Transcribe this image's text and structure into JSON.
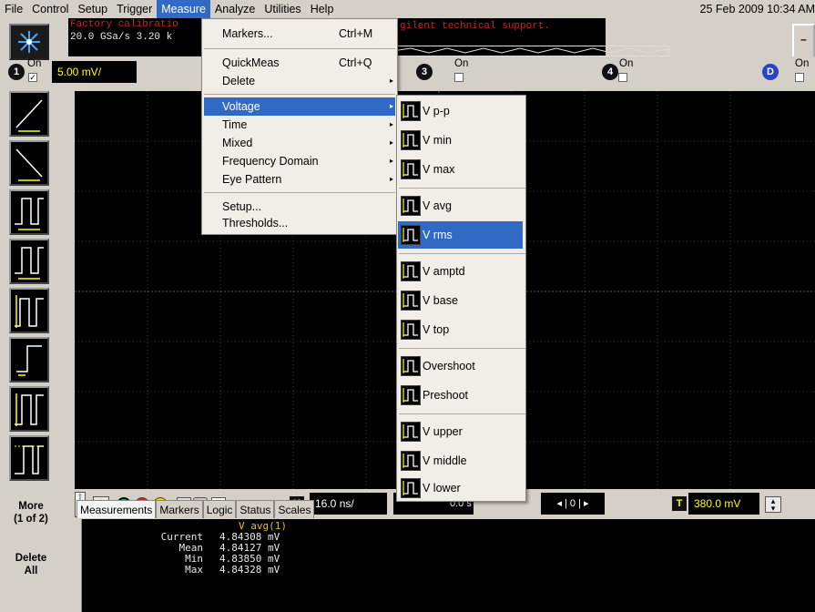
{
  "menubar": {
    "items": [
      "File",
      "Control",
      "Setup",
      "Trigger",
      "Measure",
      "Analyze",
      "Utilities",
      "Help"
    ],
    "active": "Measure",
    "datetime": "25 Feb 2009 10:34 AM"
  },
  "status": {
    "line1": "Factory calibratio",
    "line1b": "gilent technical support.",
    "line2": "20.0 GSa/s   3.20 k"
  },
  "channels": {
    "ch1": {
      "num": "1",
      "on": "On",
      "scale": "5.00 mV/"
    },
    "ch3": {
      "num": "3",
      "on": "On"
    },
    "ch4": {
      "num": "4",
      "on": "On"
    },
    "chD": {
      "num": "D",
      "on": "On"
    }
  },
  "left_panel": {
    "more": "More",
    "more_sub": "(1 of 2)",
    "delete": "Delete",
    "delete_sub": "All"
  },
  "horizontal": {
    "label": "H",
    "value": "16.0 ns/",
    "delay": "0.0 s",
    "pos_ctrl": "◂ | 0 | ▸"
  },
  "trigger": {
    "label": "T",
    "value": "380.0 mV"
  },
  "tabs": [
    "Measurements",
    "Markers",
    "Logic",
    "Status",
    "Scales"
  ],
  "measurements": {
    "title": "V avg(1)",
    "rows": [
      {
        "label": "Current",
        "value": "4.84308 mV"
      },
      {
        "label": "Mean",
        "value": "4.84127 mV"
      },
      {
        "label": "Min",
        "value": "4.83850 mV"
      },
      {
        "label": "Max",
        "value": "4.84328 mV"
      }
    ]
  },
  "measure_menu": {
    "items": [
      {
        "label": "Markers...",
        "shortcut": "Ctrl+M"
      },
      {
        "label": "QuickMeas",
        "shortcut": "Ctrl+Q"
      },
      {
        "label": "Delete",
        "arrow": "▸"
      },
      {
        "label": "Voltage",
        "arrow": "▸"
      },
      {
        "label": "Time",
        "arrow": "▸"
      },
      {
        "label": "Mixed",
        "arrow": "▸"
      },
      {
        "label": "Frequency Domain",
        "arrow": "▸"
      },
      {
        "label": "Eye Pattern",
        "arrow": "▸"
      },
      {
        "label": "Setup..."
      },
      {
        "label": "Thresholds..."
      }
    ]
  },
  "voltage_submenu": {
    "items": [
      "V p-p",
      "V min",
      "V max",
      "V avg",
      "V rms",
      "V amptd",
      "V base",
      "V top",
      "Overshoot",
      "Preshoot",
      "V upper",
      "V middle",
      "V lower"
    ],
    "highlighted": "V rms"
  },
  "colors": {
    "accent": "#316ac5",
    "ch1": "#e0c020",
    "background": "#d4d0c8"
  }
}
